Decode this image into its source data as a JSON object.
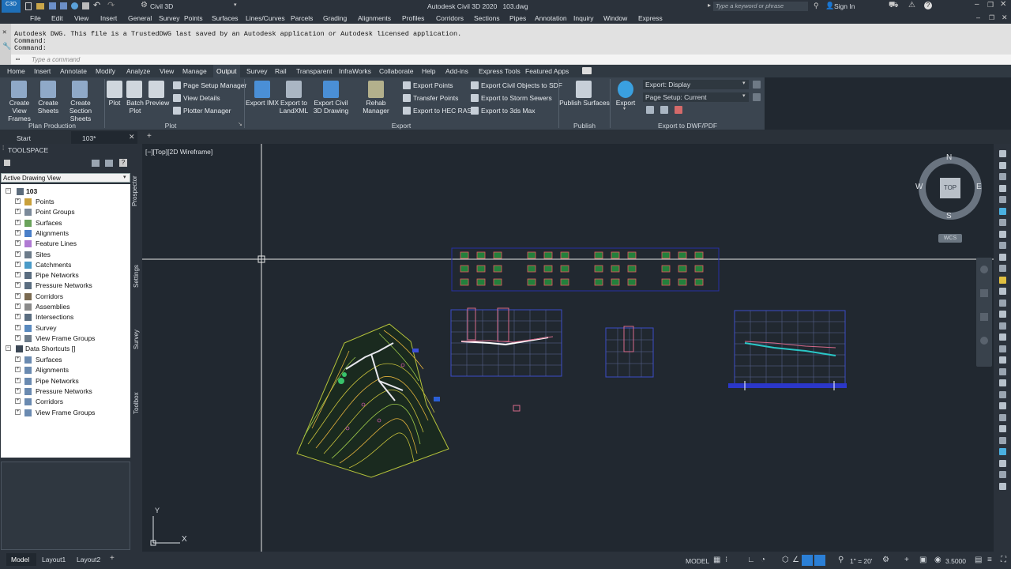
{
  "app": {
    "title": "Autodesk Civil 3D 2020",
    "file": "103.dwg",
    "workspace": "Civil 3D",
    "search_placeholder": "Type a keyword or phrase",
    "sign_in": "Sign In"
  },
  "menubar": [
    "File",
    "Edit",
    "View",
    "Insert",
    "General",
    "Survey",
    "Points",
    "Surfaces",
    "Lines/Curves",
    "Parcels",
    "Grading",
    "Alignments",
    "Profiles",
    "Corridors",
    "Sections",
    "Pipes",
    "Annotation",
    "Inquiry",
    "Window",
    "Express"
  ],
  "command": {
    "line1": "Autodesk DWG.  This file is a TrustedDWG last saved by an Autodesk application or Autodesk licensed application.",
    "line2": "Command:",
    "line3": "Command:",
    "placeholder": "Type a command"
  },
  "ribbon_tabs": [
    "Home",
    "Insert",
    "Annotate",
    "Modify",
    "Analyze",
    "View",
    "Manage",
    "Output",
    "Survey",
    "Rail",
    "Transparent",
    "InfraWorks",
    "Collaborate",
    "Help",
    "Add-ins",
    "Express Tools",
    "Featured Apps"
  ],
  "ribbon_active": "Output",
  "ribbon": {
    "plan_production": {
      "title": "Plan Production",
      "buttons": [
        "Create View Frames",
        "Create Sheets",
        "Create Section Sheets"
      ]
    },
    "plot": {
      "title": "Plot",
      "buttons": [
        "Plot",
        "Batch Plot",
        "Preview"
      ],
      "small": [
        "Page Setup Manager",
        "View Details",
        "Plotter Manager"
      ]
    },
    "export": {
      "title": "Export",
      "buttons": [
        "Export IMX",
        "Export to LandXML",
        "Export Civil 3D Drawing",
        "Rehab Manager"
      ],
      "small_col1": [
        "Export Points",
        "Transfer Points",
        "Export to HEC RAS"
      ],
      "small_col2": [
        "Export Civil Objects to SDF",
        "Export to Storm Sewers",
        "Export to 3ds Max"
      ]
    },
    "publish": {
      "title": "Publish",
      "buttons": [
        "Publish Surfaces"
      ]
    },
    "export_dwf": {
      "title": "Export to DWF/PDF",
      "button": "Export",
      "dropdown1": "Export: Display",
      "dropdown2": "Page Setup: Current"
    }
  },
  "doc_tabs": [
    "Start",
    "103*"
  ],
  "toolspace": {
    "title": "TOOLSPACE",
    "view_select": "Active Drawing View",
    "root": "103",
    "items": [
      "Points",
      "Point Groups",
      "Surfaces",
      "Alignments",
      "Feature Lines",
      "Sites",
      "Catchments",
      "Pipe Networks",
      "Pressure Networks",
      "Corridors",
      "Assemblies",
      "Intersections",
      "Survey",
      "View Frame Groups"
    ],
    "shortcuts_root": "Data Shortcuts []",
    "shortcut_items": [
      "Surfaces",
      "Alignments",
      "Pipe Networks",
      "Pressure Networks",
      "Corridors",
      "View Frame Groups"
    ],
    "side_tabs": [
      "Prospector",
      "Settings",
      "Survey",
      "Toolbox"
    ]
  },
  "viewport": {
    "label": "[−][Top][2D Wireframe]",
    "compass": {
      "n": "N",
      "s": "S",
      "e": "E",
      "w": "W",
      "top": "TOP",
      "wcs": "WCS"
    },
    "ucs_y": "Y",
    "ucs_x": "X"
  },
  "layout_tabs": [
    "Model",
    "Layout1",
    "Layout2"
  ],
  "status": {
    "mode": "MODEL",
    "scale": "1\" = 20'",
    "value": "3.5000"
  },
  "colors": {
    "background": "#212830",
    "panel": "#2b323b",
    "ribbon": "#3b4550",
    "accent": "#2b7fd6"
  }
}
